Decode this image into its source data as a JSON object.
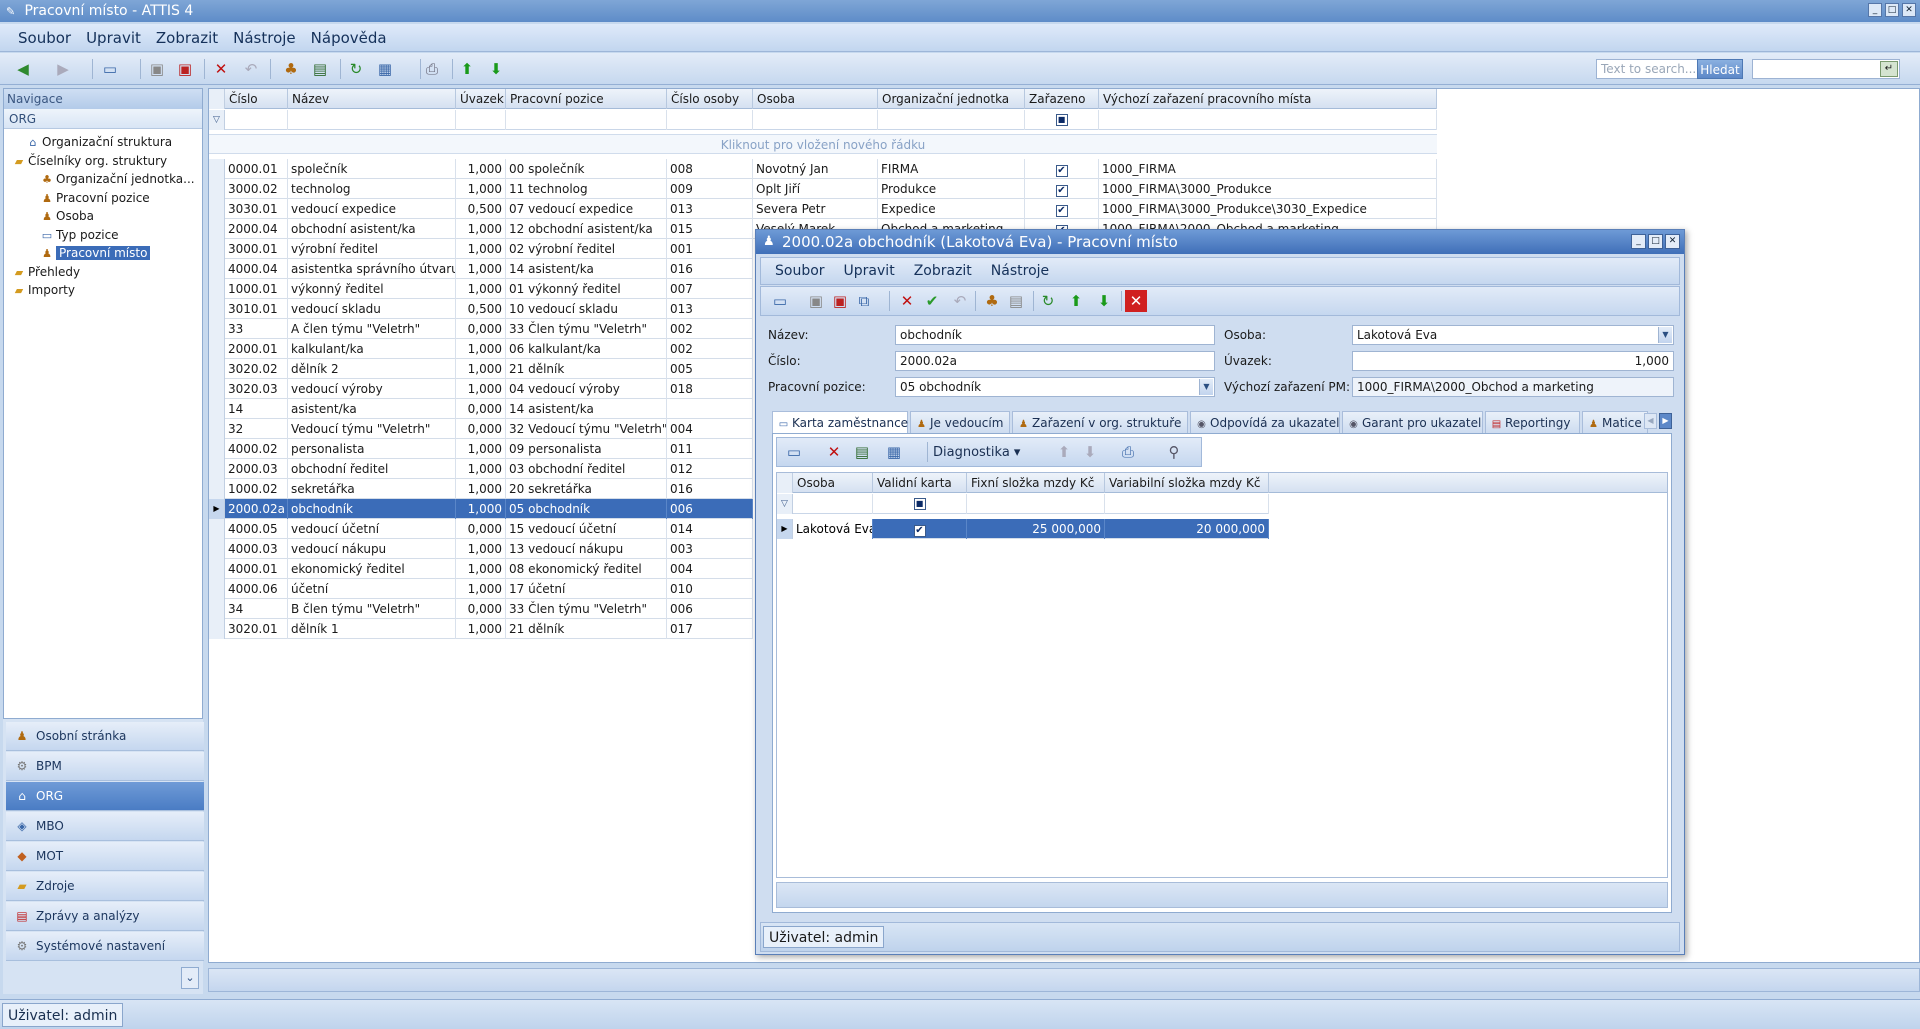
{
  "window": {
    "title": "Pracovní místo - ATTIS 4"
  },
  "menu": [
    "Soubor",
    "Upravit",
    "Zobrazit",
    "Nástroje",
    "Nápověda"
  ],
  "search": {
    "placeholder": "Text to search...",
    "button": "Hledat"
  },
  "nav": {
    "header": "Navigace",
    "section": "ORG",
    "tree": [
      {
        "label": "Organizační struktura",
        "level": 1,
        "icon": "org-chart-icon"
      },
      {
        "label": "Číselníky org. struktury",
        "level": 0,
        "icon": "folder-icon"
      },
      {
        "label": "Organizační jednotka...",
        "level": 2,
        "icon": "unit-icon"
      },
      {
        "label": "Pracovní pozice",
        "level": 2,
        "icon": "position-icon"
      },
      {
        "label": "Osoba",
        "level": 2,
        "icon": "person-icon"
      },
      {
        "label": "Typ pozice",
        "level": 2,
        "icon": "type-icon"
      },
      {
        "label": "Pracovní místo",
        "level": 2,
        "icon": "workplace-icon",
        "selected": true
      },
      {
        "label": "Přehledy",
        "level": 0,
        "icon": "folder-icon"
      },
      {
        "label": "Importy",
        "level": 0,
        "icon": "folder-icon"
      }
    ],
    "modules": [
      {
        "label": "Osobní stránka",
        "icon": "person-icon"
      },
      {
        "label": "BPM",
        "icon": "bpm-icon"
      },
      {
        "label": "ORG",
        "icon": "org-icon",
        "active": true
      },
      {
        "label": "MBO",
        "icon": "mbo-icon"
      },
      {
        "label": "MOT",
        "icon": "mot-icon"
      },
      {
        "label": "Zdroje",
        "icon": "folder-icon"
      },
      {
        "label": "Zprávy a analýzy",
        "icon": "report-icon"
      },
      {
        "label": "Systémové nastavení",
        "icon": "gear-icon"
      }
    ]
  },
  "grid": {
    "columns": [
      "Číslo",
      "Název",
      "Úvazek",
      "Pracovní pozice",
      "Číslo osoby",
      "Osoba",
      "Organizační jednotka",
      "Zařazeno",
      "Výchozí zařazení pracovního místa"
    ],
    "new_row": "Kliknout pro vložení nového řádku",
    "rows": [
      [
        "0000.01",
        "společník",
        "1,000",
        "00 společník",
        "008",
        "Novotný Jan",
        "FIRMA",
        true,
        "1000_FIRMA"
      ],
      [
        "3000.02",
        "technolog",
        "1,000",
        "11 technolog",
        "009",
        "Oplt Jiří",
        "Produkce",
        true,
        "1000_FIRMA\\3000_Produkce"
      ],
      [
        "3030.01",
        "vedoucí expedice",
        "0,500",
        "07 vedoucí expedice",
        "013",
        "Severa Petr",
        "Expedice",
        true,
        "1000_FIRMA\\3000_Produkce\\3030_Expedice"
      ],
      [
        "2000.04",
        "obchodní asistent/ka",
        "1,000",
        "12 obchodní asistent/ka",
        "015",
        "Veselý Marek",
        "Obchod a marketing",
        true,
        "1000_FIRMA\\2000_Obchod a marketing"
      ],
      [
        "3000.01",
        "výrobní ředitel",
        "1,000",
        "02 výrobní ředitel",
        "001",
        "",
        "",
        false,
        ""
      ],
      [
        "4000.04",
        "asistentka správního útvaru",
        "1,000",
        "14 asistent/ka",
        "016",
        "",
        "",
        false,
        ""
      ],
      [
        "1000.01",
        "výkonný ředitel",
        "1,000",
        "01 výkonný ředitel",
        "007",
        "",
        "",
        false,
        ""
      ],
      [
        "3010.01",
        "vedoucí skladu",
        "0,500",
        "10 vedoucí skladu",
        "013",
        "",
        "",
        false,
        ""
      ],
      [
        "33",
        "A člen týmu \"Veletrh\"",
        "0,000",
        "33 Člen týmu \"Veletrh\"",
        "002",
        "",
        "",
        false,
        ""
      ],
      [
        "2000.01",
        "kalkulant/ka",
        "1,000",
        "06 kalkulant/ka",
        "002",
        "",
        "",
        false,
        ""
      ],
      [
        "3020.02",
        "dělník 2",
        "1,000",
        "21 dělník",
        "005",
        "",
        "",
        false,
        ""
      ],
      [
        "3020.03",
        "vedoucí výroby",
        "1,000",
        "04 vedoucí výroby",
        "018",
        "",
        "",
        false,
        ""
      ],
      [
        "14",
        "asistent/ka",
        "0,000",
        "14 asistent/ka",
        "",
        "",
        "",
        false,
        ""
      ],
      [
        "32",
        "Vedoucí týmu \"Veletrh\"",
        "0,000",
        "32 Vedoucí týmu \"Veletrh\"",
        "004",
        "",
        "",
        false,
        ""
      ],
      [
        "4000.02",
        "personalista",
        "1,000",
        "09 personalista",
        "011",
        "",
        "",
        false,
        ""
      ],
      [
        "2000.03",
        "obchodní ředitel",
        "1,000",
        "03 obchodní ředitel",
        "012",
        "",
        "",
        false,
        ""
      ],
      [
        "1000.02",
        "sekretářka",
        "1,000",
        "20 sekretářka",
        "016",
        "",
        "",
        false,
        ""
      ],
      [
        "2000.02a",
        "obchodník",
        "1,000",
        "05 obchodník",
        "006",
        "",
        "",
        false,
        ""
      ],
      [
        "4000.05",
        "vedoucí účetní",
        "0,000",
        "15 vedoucí účetní",
        "014",
        "",
        "",
        false,
        ""
      ],
      [
        "4000.03",
        "vedoucí nákupu",
        "1,000",
        "13 vedoucí nákupu",
        "003",
        "",
        "",
        false,
        ""
      ],
      [
        "4000.01",
        "ekonomický ředitel",
        "1,000",
        "08 ekonomický ředitel",
        "004",
        "",
        "",
        false,
        ""
      ],
      [
        "4000.06",
        "účetní",
        "1,000",
        "17 účetní",
        "010",
        "",
        "",
        false,
        ""
      ],
      [
        "34",
        "B člen týmu \"Veletrh\"",
        "0,000",
        "33 Člen týmu \"Veletrh\"",
        "006",
        "",
        "",
        false,
        ""
      ],
      [
        "3020.01",
        "dělník 1",
        "1,000",
        "21 dělník",
        "017",
        "",
        "",
        false,
        ""
      ]
    ],
    "selected_row": 17
  },
  "status": {
    "user": "Uživatel: admin"
  },
  "dialog": {
    "title": "2000.02a obchodník (Lakotová Eva) - Pracovní místo",
    "menu": [
      "Soubor",
      "Upravit",
      "Zobrazit",
      "Nástroje"
    ],
    "fields": {
      "nazev_label": "Název:",
      "nazev": "obchodník",
      "cislo_label": "Číslo:",
      "cislo": "2000.02a",
      "pozice_label": "Pracovní pozice:",
      "pozice": "05 obchodník",
      "osoba_label": "Osoba:",
      "osoba": "Lakotová Eva",
      "uvazek_label": "Úvazek:",
      "uvazek": "1,000",
      "vychozi_label": "Výchozí zařazení PM:",
      "vychozi": "1000_FIRMA\\2000_Obchod a marketing"
    },
    "tabs": [
      {
        "label": "Karta zaměstnance",
        "icon": "card-icon",
        "active": true
      },
      {
        "label": "Je vedoucím",
        "icon": "people-icon"
      },
      {
        "label": "Zařazení v org. struktuře",
        "icon": "person-icon"
      },
      {
        "label": "Odpovídá za ukazatel",
        "icon": "eye-icon"
      },
      {
        "label": "Garant pro ukazatel",
        "icon": "eye-icon"
      },
      {
        "label": "Reportingy",
        "icon": "report-icon"
      },
      {
        "label": "Matice",
        "icon": "people-icon"
      }
    ],
    "subtoolbar": {
      "diagnostika": "Diagnostika"
    },
    "subgrid": {
      "columns": [
        "Osoba",
        "Validní karta",
        "Fixní složka mzdy Kč",
        "Variabilní složka mzdy Kč"
      ],
      "rows": [
        [
          "Lakotová Eva",
          true,
          "25 000,000",
          "20 000,000"
        ]
      ]
    },
    "status": "Uživatel: admin"
  }
}
